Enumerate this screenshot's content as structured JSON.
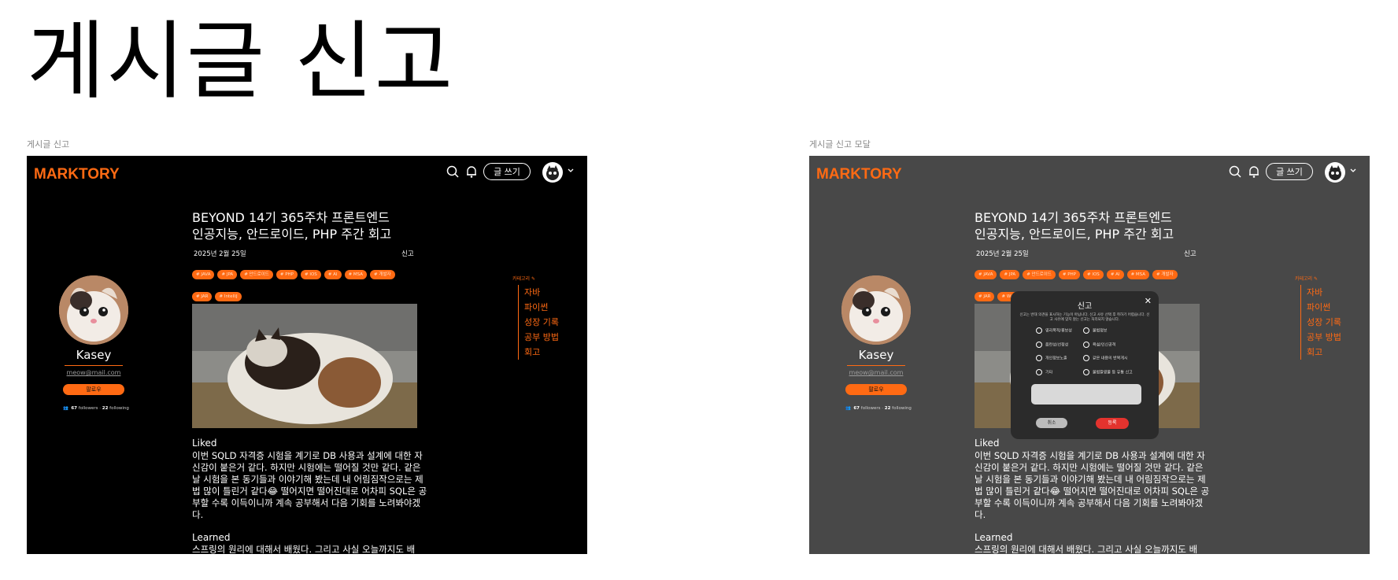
{
  "page_title": "게시글 신고",
  "frames": [
    {
      "label": "게시글 신고"
    },
    {
      "label": "게시글 신고 모달"
    }
  ],
  "header": {
    "logo_text": "MARKTORY",
    "write_label": "글 쓰기"
  },
  "profile": {
    "name": "Kasey",
    "email": "meow@mail.com",
    "follow_label": "팔로우",
    "followers_count": "67",
    "followers_label": "followers",
    "separator": "·",
    "following_count": "22",
    "following_label": "following"
  },
  "post": {
    "title": "BEYOND 14기 365주차 프론트엔드 인공지능, 안드로이드, PHP 주간 회고",
    "date": "2025년 2월 25일",
    "report_label": "신고",
    "tags": [
      "# JAVA",
      "# JPA",
      "# 안드로이드",
      "# PHP",
      "# IOS",
      "# AI",
      "# MSA",
      "# 개발자",
      "# JAR",
      "# IntelliJ"
    ],
    "tags_modal": [
      "# JAVA",
      "# JPA",
      "# 안드로이드",
      "# PHP",
      "# IOS",
      "# AI",
      "# MSA",
      "# 개발자",
      "# JAR",
      "# WAR"
    ],
    "section1_title": "Liked",
    "section1_body": "이번 SQLD 자격증 시험을 계기로 DB 사용과 설계에 대한 자신감이 붙은거 같다. 하지만 시험에는 떨어질 것만 같다. 같은 날 시험을 본 동기들과 이야기해 봤는데 내 어림짐작으로는 제법 많이 틀린거 같다😂 떨어지면 떨어진대로 어차피 SQL은 공부할 수록 이득이니까 계속 공부해서 다음 기회를 노려봐야겠다.",
    "section2_title": "Learned",
    "section2_body": "스프링의 원리에 대해서 배웠다. 그리고 사실 오늘까지도 배"
  },
  "categories": {
    "header": "카테고리 ✎",
    "items": [
      "자바",
      "파이썬",
      "성장 기록",
      "공부 방법",
      "회고"
    ]
  },
  "modal": {
    "title": "신고",
    "close": "✕",
    "description": "신고는 반대 의견을 표시하는 기능이 아닙니다. 신고 사유 선택 후 취하기 어렵습니다. 신고 사유에 맞지 않는 신고는 처리되지 않습니다.",
    "options": [
      "영리목적/홍보성",
      "음란성/선정성",
      "개인정보노출",
      "기타",
      "불법정보",
      "욕설/인신공격",
      "같은 내용의 반복게시",
      "불법촬영물 등 유통 신고"
    ],
    "cancel_label": "취소",
    "submit_label": "등록"
  },
  "colors": {
    "accent": "#ff6a13",
    "danger": "#e3332e",
    "frame_bg": "#000000",
    "dim_bg": "#484848"
  }
}
